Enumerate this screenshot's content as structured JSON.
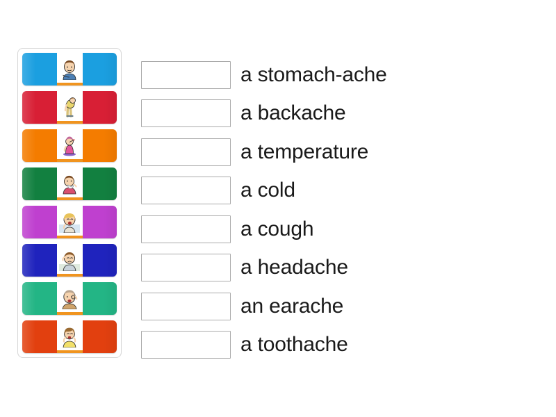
{
  "tray": {
    "name": "image-tile-tray",
    "tiles": [
      {
        "id": "tile-1",
        "color": "#1b9fe0",
        "icon": "boy-holding-stomach-illustration",
        "alt": "boy holding his stomach"
      },
      {
        "id": "tile-2",
        "color": "#d81f35",
        "icon": "person-bending-with-back-pain-illustration",
        "alt": "person bent over with back pain"
      },
      {
        "id": "tile-3",
        "color": "#f47c00",
        "icon": "woman-with-thermometer-illustration",
        "alt": "woman taking her temperature"
      },
      {
        "id": "tile-4",
        "color": "#128040",
        "icon": "person-blowing-nose-illustration",
        "alt": "person blowing nose with tissue"
      },
      {
        "id": "tile-5",
        "color": "#bf40cf",
        "icon": "girl-coughing-illustration",
        "alt": "girl coughing"
      },
      {
        "id": "tile-6",
        "color": "#1f23bd",
        "icon": "boy-holding-head-illustration",
        "alt": "boy holding his head"
      },
      {
        "id": "tile-7",
        "color": "#23b585",
        "icon": "man-holding-ear-illustration",
        "alt": "man holding his ear"
      },
      {
        "id": "tile-8",
        "color": "#e2400f",
        "icon": "girl-holding-jaw-illustration",
        "alt": "girl holding her jaw"
      }
    ]
  },
  "answers": {
    "name": "answer-list",
    "input_placeholder": "",
    "rows": [
      {
        "value": "",
        "label": "a stomach-ache"
      },
      {
        "value": "",
        "label": "a backache"
      },
      {
        "value": "",
        "label": "a temperature"
      },
      {
        "value": "",
        "label": "a cold"
      },
      {
        "value": "",
        "label": "a cough"
      },
      {
        "value": "",
        "label": "a headache"
      },
      {
        "value": "",
        "label": "an earache"
      },
      {
        "value": "",
        "label": "a toothache"
      }
    ]
  },
  "style": {
    "card_base_color": "#f0941f",
    "tray_border_color": "#d6d6d6",
    "input_border_color": "#aaaaaa",
    "text_color": "#1a1a1a",
    "page_background": "#ffffff"
  }
}
